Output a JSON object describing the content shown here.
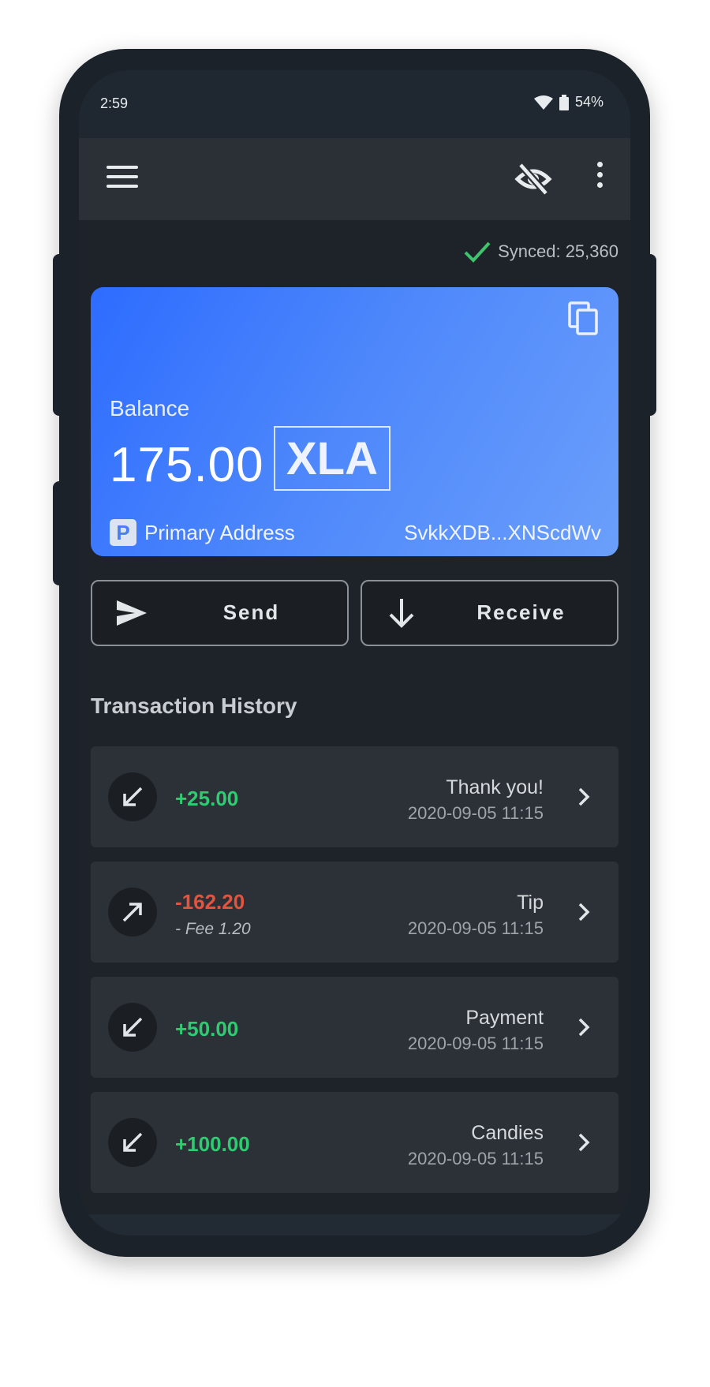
{
  "status_bar": {
    "time": "2:59",
    "battery": "54%",
    "wifi_icon": "wifi-icon",
    "battery_icon": "battery-icon"
  },
  "app_bar": {
    "menu_icon": "menu-icon",
    "hide_icon": "eye-off-icon",
    "more_icon": "more-vert-icon"
  },
  "sync": {
    "text": "Synced: 25,360",
    "icon": "check-icon",
    "color": "#3ec46d"
  },
  "balance_card": {
    "label": "Balance",
    "amount": "175.00",
    "ticker": "XLA",
    "address_badge": "P",
    "address_label": "Primary Address",
    "address_value": "SvkkXDB...XNScdWv",
    "copy_icon": "copy-icon",
    "gradient": [
      "#2d6cff",
      "#6b9ffb"
    ]
  },
  "actions": {
    "send_label": "Send",
    "receive_label": "Receive"
  },
  "history": {
    "title": "Transaction History",
    "items": [
      {
        "direction": "incoming",
        "amount": "+25.00",
        "fee": "",
        "note": "Thank you!",
        "date": "2020-09-05 11:15"
      },
      {
        "direction": "outgoing",
        "amount": "-162.20",
        "fee": "- Fee 1.20",
        "note": "Tip",
        "date": "2020-09-05 11:15"
      },
      {
        "direction": "incoming",
        "amount": "+50.00",
        "fee": "",
        "note": "Payment",
        "date": "2020-09-05 11:15"
      },
      {
        "direction": "incoming",
        "amount": "+100.00",
        "fee": "",
        "note": "Candies",
        "date": "2020-09-05 11:15"
      }
    ]
  },
  "colors": {
    "positive": "#2ecc71",
    "negative": "#e5533d",
    "background": "#1e2329"
  }
}
